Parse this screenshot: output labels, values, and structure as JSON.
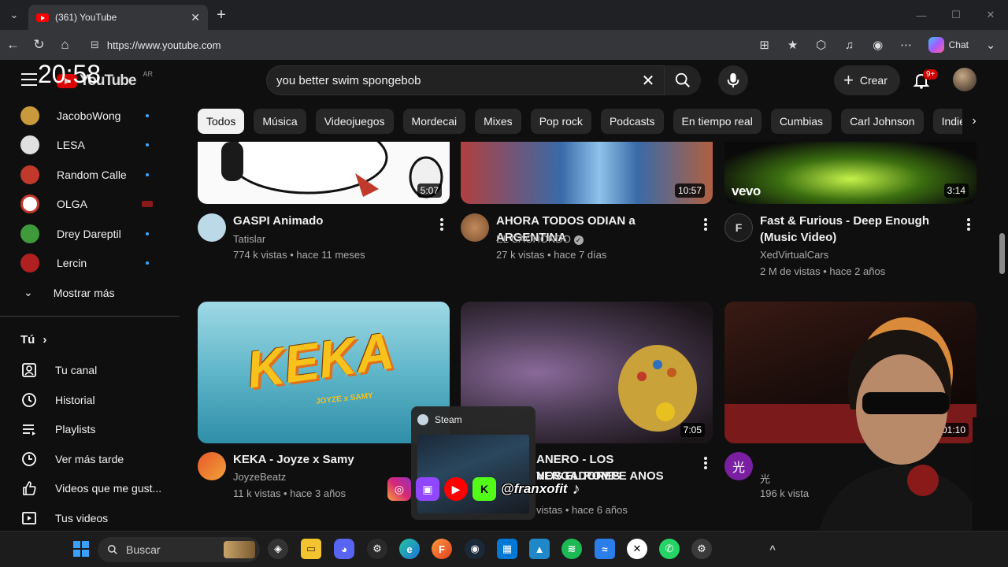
{
  "browser": {
    "tab_title": "(361) YouTube",
    "url": "https://www.youtube.com",
    "copilot_label": "Chat"
  },
  "overlay": {
    "clock": "20:58",
    "social_handle": "@franxofit"
  },
  "header": {
    "logo_text": "YouTube",
    "country_code": "AR",
    "search_query": "you better swim spongebob",
    "create_label": "Crear",
    "notif_count": "9+"
  },
  "sidebar": {
    "subscriptions": [
      {
        "name": "JacoboWong",
        "color": "#c89a3c"
      },
      {
        "name": "LESA",
        "color": "#e0e0e0"
      },
      {
        "name": "Random Calle",
        "color": "#c0392b"
      },
      {
        "name": "OLGA",
        "color": "#ffffff"
      },
      {
        "name": "Drey Dareptil",
        "color": "#3f9a3c"
      },
      {
        "name": "Lercin",
        "color": "#b02020"
      }
    ],
    "show_more": "Mostrar más",
    "you_label": "Tú",
    "you_items": [
      {
        "label": "Tu canal",
        "icon": "channel-icon"
      },
      {
        "label": "Historial",
        "icon": "history-icon"
      },
      {
        "label": "Playlists",
        "icon": "playlists-icon"
      },
      {
        "label": "Ver más tarde",
        "icon": "watch-later-icon"
      },
      {
        "label": "Videos que me gust...",
        "icon": "like-icon"
      },
      {
        "label": "Tus videos",
        "icon": "your-videos-icon"
      }
    ]
  },
  "chips": [
    "Todos",
    "Música",
    "Videojuegos",
    "Mordecai",
    "Mixes",
    "Pop rock",
    "Podcasts",
    "En tiempo real",
    "Cumbias",
    "Carl Johnson",
    "Indie roc"
  ],
  "videos": [
    {
      "title": "GASPI Animado",
      "channel": "Tatislar",
      "meta": "774 k vistas • hace 11 meses",
      "duration": "5:07"
    },
    {
      "title": "AHORA TODOS ODIAN a ARGENTINA",
      "channel": "EL CACHONDO",
      "meta": "27 k vistas • hace 7 días",
      "duration": "10:57"
    },
    {
      "title": "Fast & Furious - Deep Enough (Music Video)",
      "channel": "XedVirtualCars",
      "meta": "2 M de vistas • hace 2 años",
      "duration": "3:14",
      "brand": "vevo"
    },
    {
      "title": "KEKA - Joyze x Samy",
      "channel": "JoyzeBeatz",
      "meta": "11 k vistas • hace 3 años",
      "thumb_text": "KEKA",
      "thumb_sub": "JOYZE x SAMY"
    },
    {
      "title_line1": "ANERO - LOS VERGADORES",
      "title_line2": "NOS EL ROMPE ANOS",
      "meta": "vistas • hace 6 años",
      "duration": "7:05"
    },
    {
      "channel_initial": "光",
      "channel": "光",
      "meta": "196 k vista",
      "duration": "01:10"
    }
  ],
  "steam_preview": {
    "label": "Steam"
  },
  "taskbar": {
    "search_label": "Buscar"
  },
  "colors": {
    "accent_red": "#ff0000",
    "chip_active_bg": "#f1f1f1",
    "bg": "#0f0f0f"
  }
}
